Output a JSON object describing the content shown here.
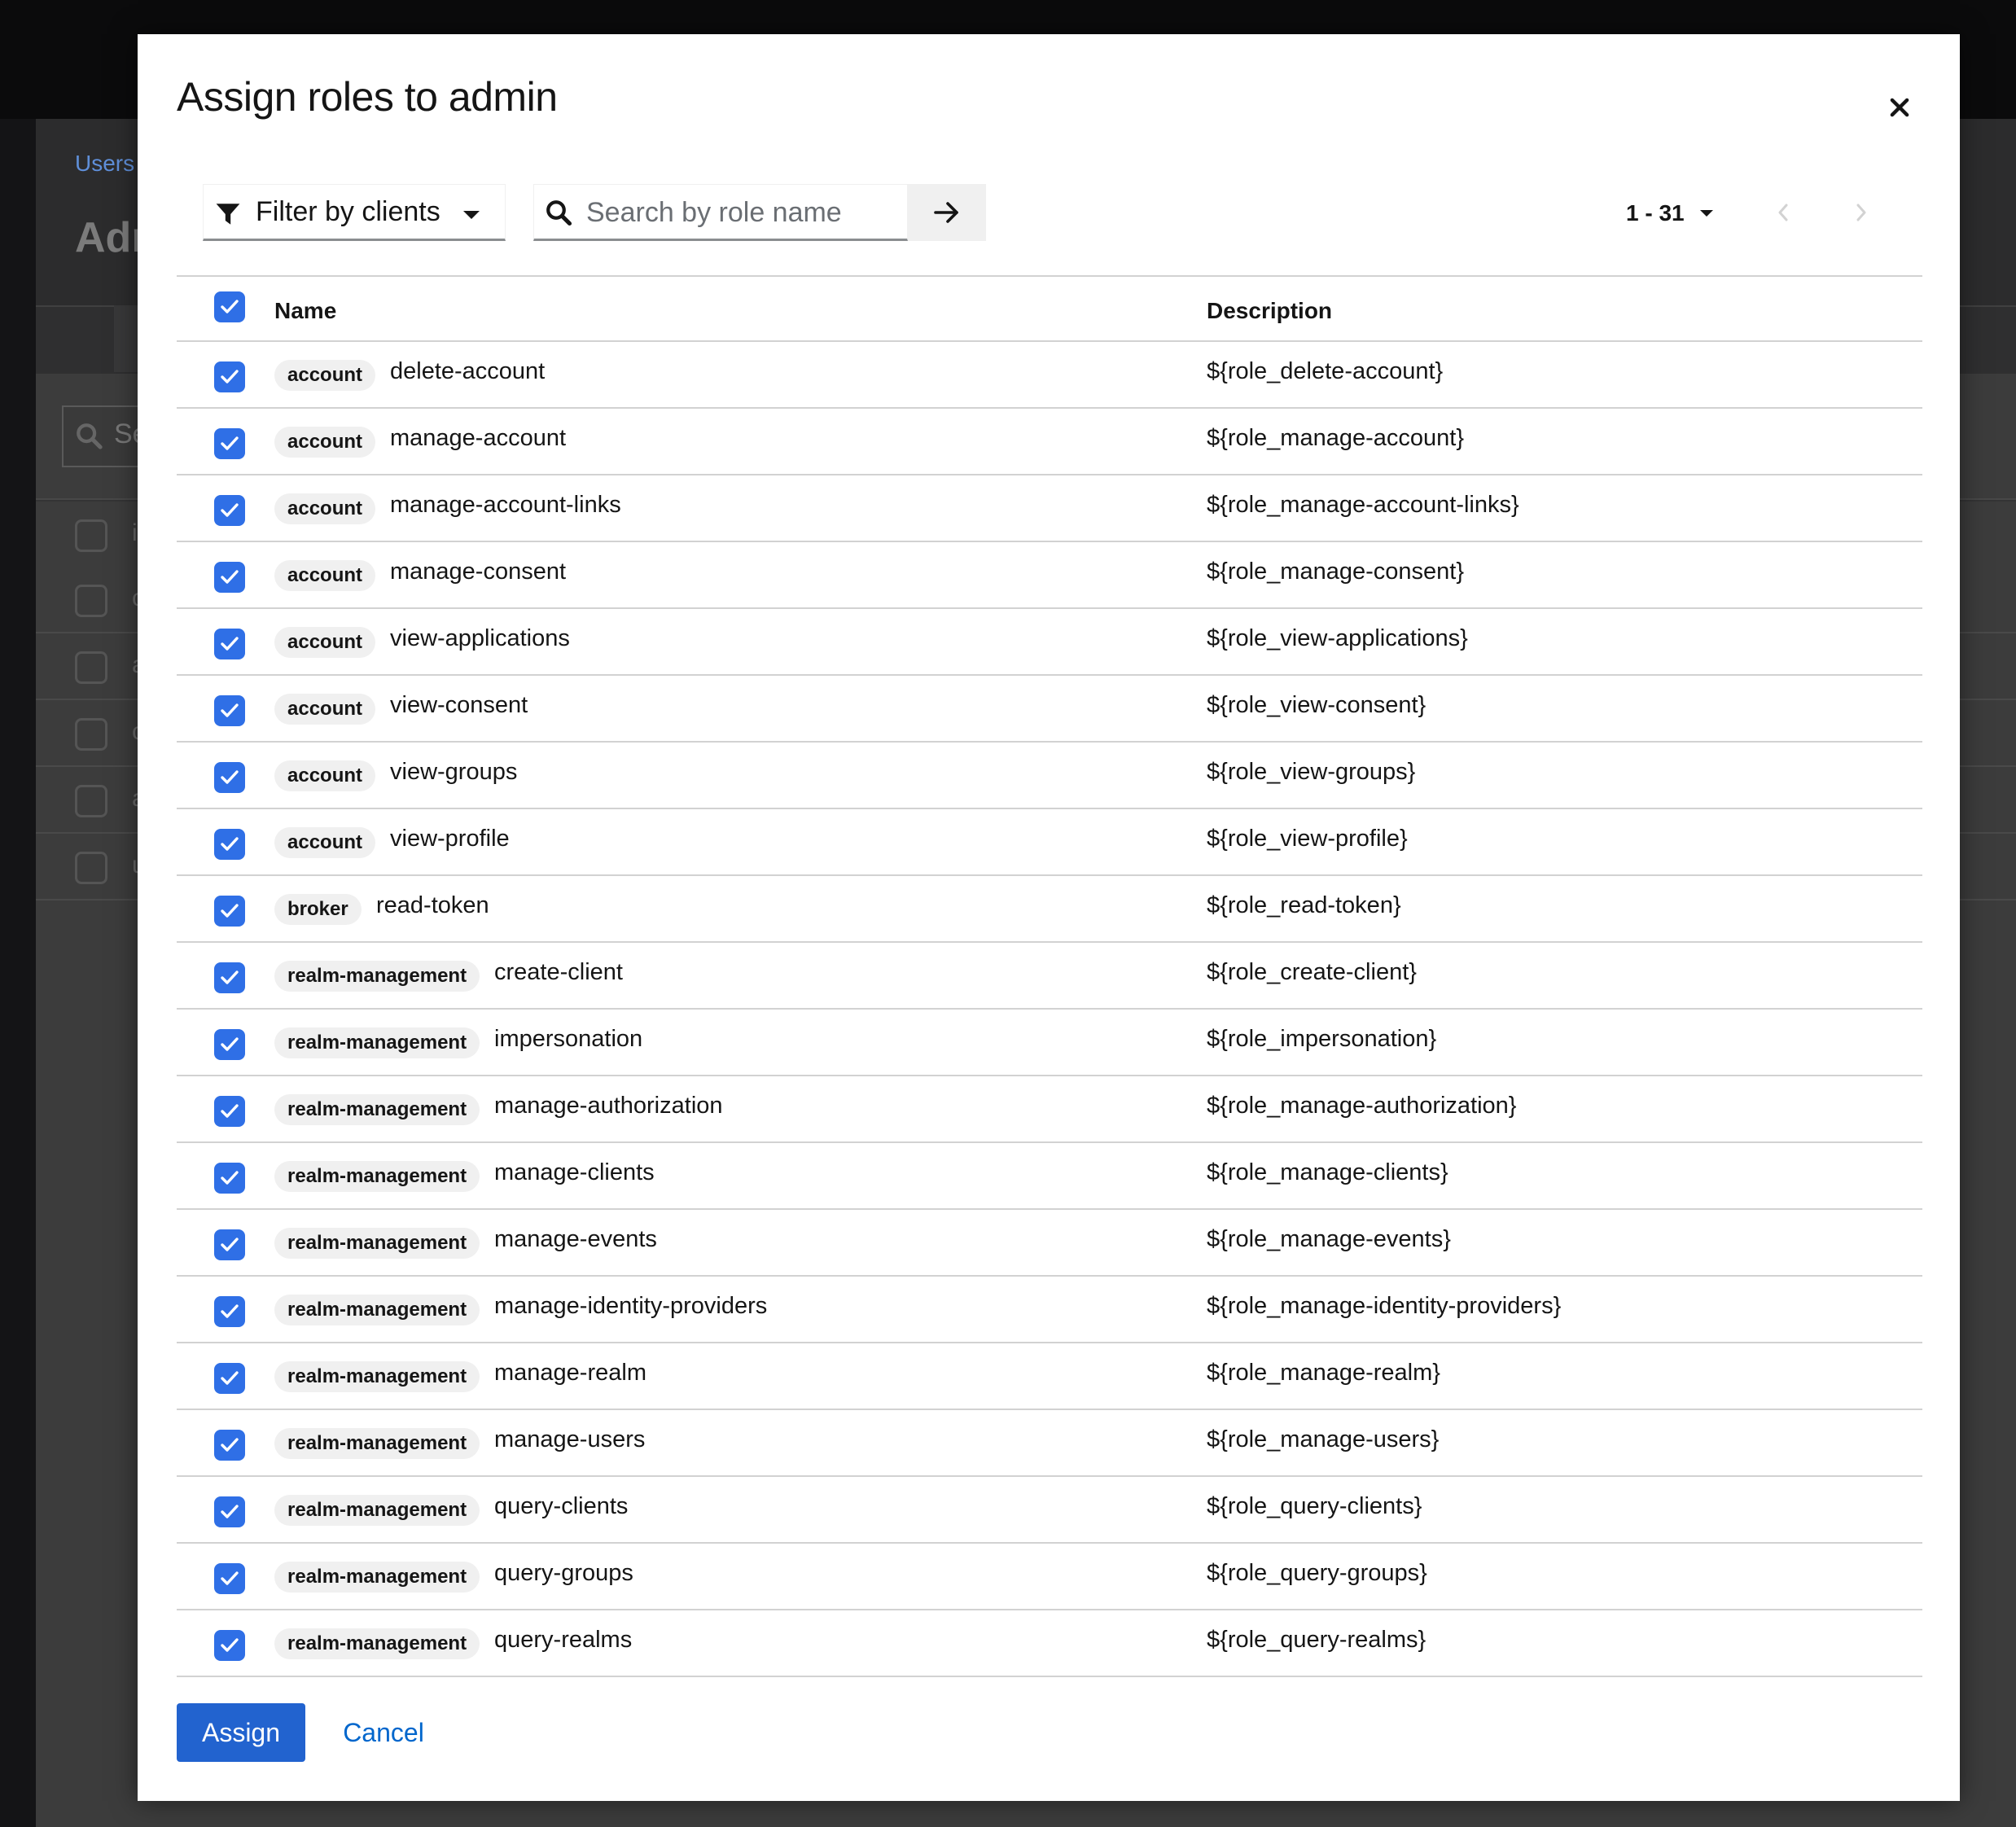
{
  "background": {
    "breadcrumb": "Users",
    "title": "Adr",
    "search_text": "Se",
    "row_initials": [
      "i",
      "c",
      "a",
      "c",
      "a",
      "u"
    ]
  },
  "modal": {
    "title": "Assign roles to admin",
    "toolbar": {
      "filter_label": "Filter by clients",
      "search_placeholder": "Search by role name",
      "pagination_label": "1 - 31"
    },
    "table": {
      "columns": [
        "Name",
        "Description"
      ],
      "rows": [
        {
          "client": "account",
          "name": "delete-account",
          "description": "${role_delete-account}"
        },
        {
          "client": "account",
          "name": "manage-account",
          "description": "${role_manage-account}"
        },
        {
          "client": "account",
          "name": "manage-account-links",
          "description": "${role_manage-account-links}"
        },
        {
          "client": "account",
          "name": "manage-consent",
          "description": "${role_manage-consent}"
        },
        {
          "client": "account",
          "name": "view-applications",
          "description": "${role_view-applications}"
        },
        {
          "client": "account",
          "name": "view-consent",
          "description": "${role_view-consent}"
        },
        {
          "client": "account",
          "name": "view-groups",
          "description": "${role_view-groups}"
        },
        {
          "client": "account",
          "name": "view-profile",
          "description": "${role_view-profile}"
        },
        {
          "client": "broker",
          "name": "read-token",
          "description": "${role_read-token}"
        },
        {
          "client": "realm-management",
          "name": "create-client",
          "description": "${role_create-client}"
        },
        {
          "client": "realm-management",
          "name": "impersonation",
          "description": "${role_impersonation}"
        },
        {
          "client": "realm-management",
          "name": "manage-authorization",
          "description": "${role_manage-authorization}"
        },
        {
          "client": "realm-management",
          "name": "manage-clients",
          "description": "${role_manage-clients}"
        },
        {
          "client": "realm-management",
          "name": "manage-events",
          "description": "${role_manage-events}"
        },
        {
          "client": "realm-management",
          "name": "manage-identity-providers",
          "description": "${role_manage-identity-providers}"
        },
        {
          "client": "realm-management",
          "name": "manage-realm",
          "description": "${role_manage-realm}"
        },
        {
          "client": "realm-management",
          "name": "manage-users",
          "description": "${role_manage-users}"
        },
        {
          "client": "realm-management",
          "name": "query-clients",
          "description": "${role_query-clients}"
        },
        {
          "client": "realm-management",
          "name": "query-groups",
          "description": "${role_query-groups}"
        },
        {
          "client": "realm-management",
          "name": "query-realms",
          "description": "${role_query-realms}"
        }
      ]
    },
    "footer": {
      "assign_label": "Assign",
      "cancel_label": "Cancel"
    }
  },
  "colors": {
    "checkbox": "#2f6fe6",
    "primary_button": "#2263cf",
    "link": "#0066cc",
    "badge_bg": "#f0f0f0"
  },
  "icons": [
    "close-icon",
    "filter-icon",
    "caret-down-icon",
    "search-icon",
    "arrow-right-icon",
    "angle-left-icon",
    "angle-right-icon",
    "check-icon"
  ]
}
